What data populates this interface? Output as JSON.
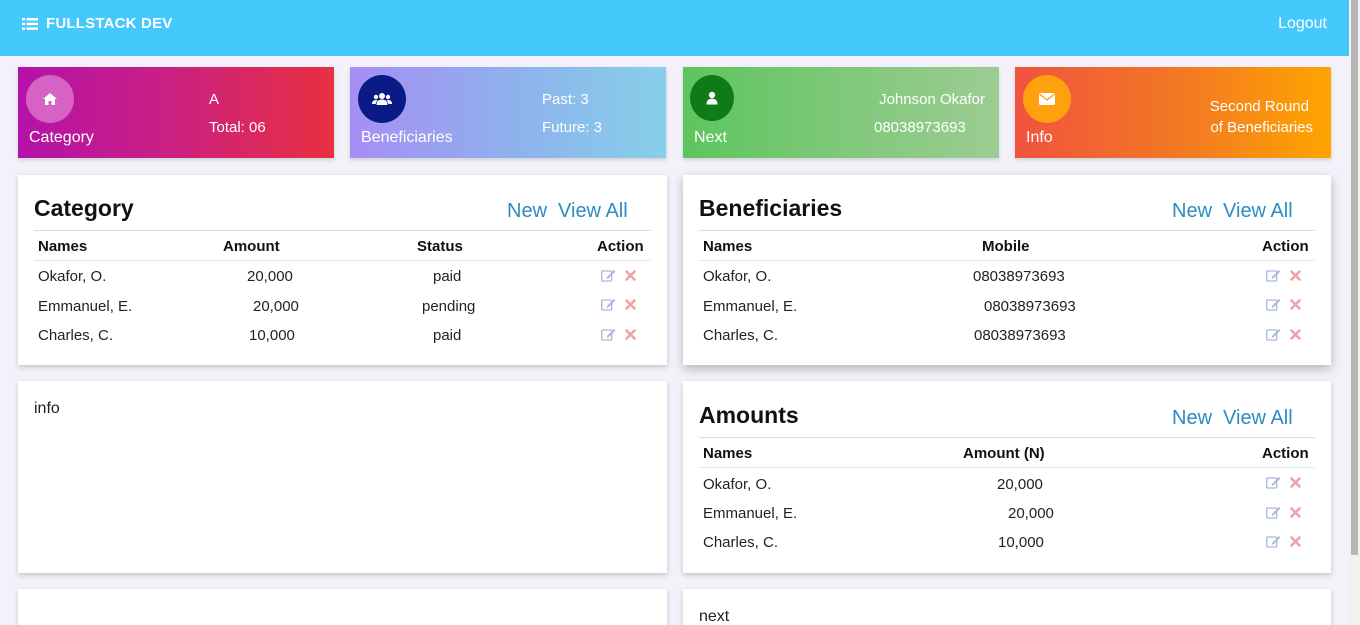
{
  "header": {
    "brand": "FULLSTACK DEV",
    "logout": "Logout"
  },
  "stats": [
    {
      "label": "Category",
      "line1": "A",
      "line2": "Total: 06",
      "icon": "home-icon"
    },
    {
      "label": "Beneficiaries",
      "line1": "Past: 3",
      "line2": "Future: 3",
      "icon": "users-icon"
    },
    {
      "label": "Next",
      "line1": "Johnson Okafor",
      "line2": "08038973693",
      "icon": "user-icon"
    },
    {
      "label": "Info",
      "line1": "Second Round",
      "line2": "of Beneficiaries",
      "icon": "envelope-icon"
    }
  ],
  "links": {
    "new": "New",
    "view_all": "View All"
  },
  "category": {
    "title": "Category",
    "headers": [
      "Names",
      "Amount",
      "Status",
      "Action"
    ],
    "rows": [
      {
        "name": "Okafor, O.",
        "amount": "20,000",
        "status": "paid"
      },
      {
        "name": "Emmanuel, E.",
        "amount": "20,000",
        "status": "pending"
      },
      {
        "name": "Charles, C.",
        "amount": "10,000",
        "status": "paid"
      }
    ]
  },
  "beneficiaries": {
    "title": "Beneficiaries",
    "headers": [
      "Names",
      "Mobile",
      "Action"
    ],
    "rows": [
      {
        "name": "Okafor, O.",
        "mobile": "08038973693"
      },
      {
        "name": "Emmanuel, E.",
        "mobile": "08038973693"
      },
      {
        "name": "Charles, C.",
        "mobile": "08038973693"
      }
    ]
  },
  "info_panel": {
    "text": "info"
  },
  "amounts": {
    "title": "Amounts",
    "headers": [
      "Names",
      "Amount (N)",
      "Action"
    ],
    "rows": [
      {
        "name": "Okafor, O.",
        "amount": "20,000"
      },
      {
        "name": "Emmanuel, E.",
        "amount": "20,000"
      },
      {
        "name": "Charles, C.",
        "amount": "10,000"
      }
    ]
  },
  "next_panel": {
    "text": "next"
  },
  "colors": {
    "topbar": "#45c8fb",
    "link": "#2b8cbf",
    "edit_icon": "#a9b7dc",
    "delete_icon": "#f0a3a3"
  }
}
